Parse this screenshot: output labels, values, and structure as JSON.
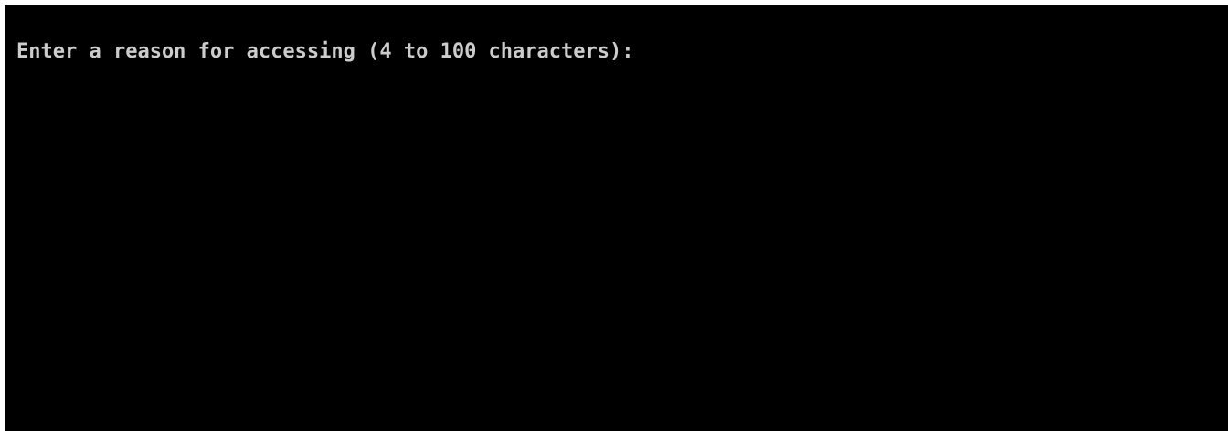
{
  "terminal": {
    "prompt_text": "Enter a reason for accessing (4 to 100 characters):",
    "input_value": "",
    "colors": {
      "background": "#000000",
      "foreground": "#cccccc",
      "outer_border": "#ffffff"
    }
  }
}
